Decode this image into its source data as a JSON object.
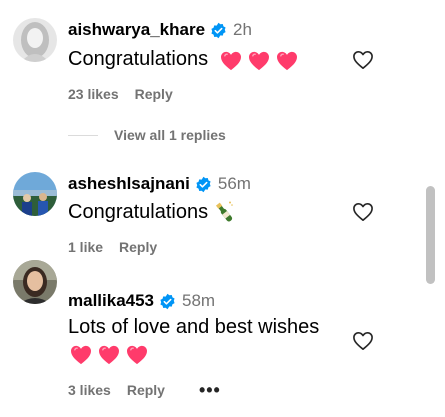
{
  "comments": [
    {
      "username": "aishwarya_khare",
      "time": "2h",
      "text": "Congratulations",
      "emoji": [
        "heart",
        "heart",
        "heart"
      ],
      "likes": "23 likes",
      "reply": "Reply",
      "view_replies": "View all 1 replies"
    },
    {
      "username": "asheshlsajnani",
      "time": "56m",
      "text": "Congratulations",
      "emoji": [
        "bottle"
      ],
      "likes": "1 like",
      "reply": "Reply"
    },
    {
      "username": "mallika453",
      "time": "58m",
      "text": "Lots of love and best wishes",
      "emoji": [
        "heart",
        "heart",
        "heart"
      ],
      "likes": "3 likes",
      "reply": "Reply",
      "more": "•••"
    }
  ],
  "colors": {
    "verified": "#0095f6",
    "heart": "#ff3b6b",
    "muted": "#737373"
  }
}
